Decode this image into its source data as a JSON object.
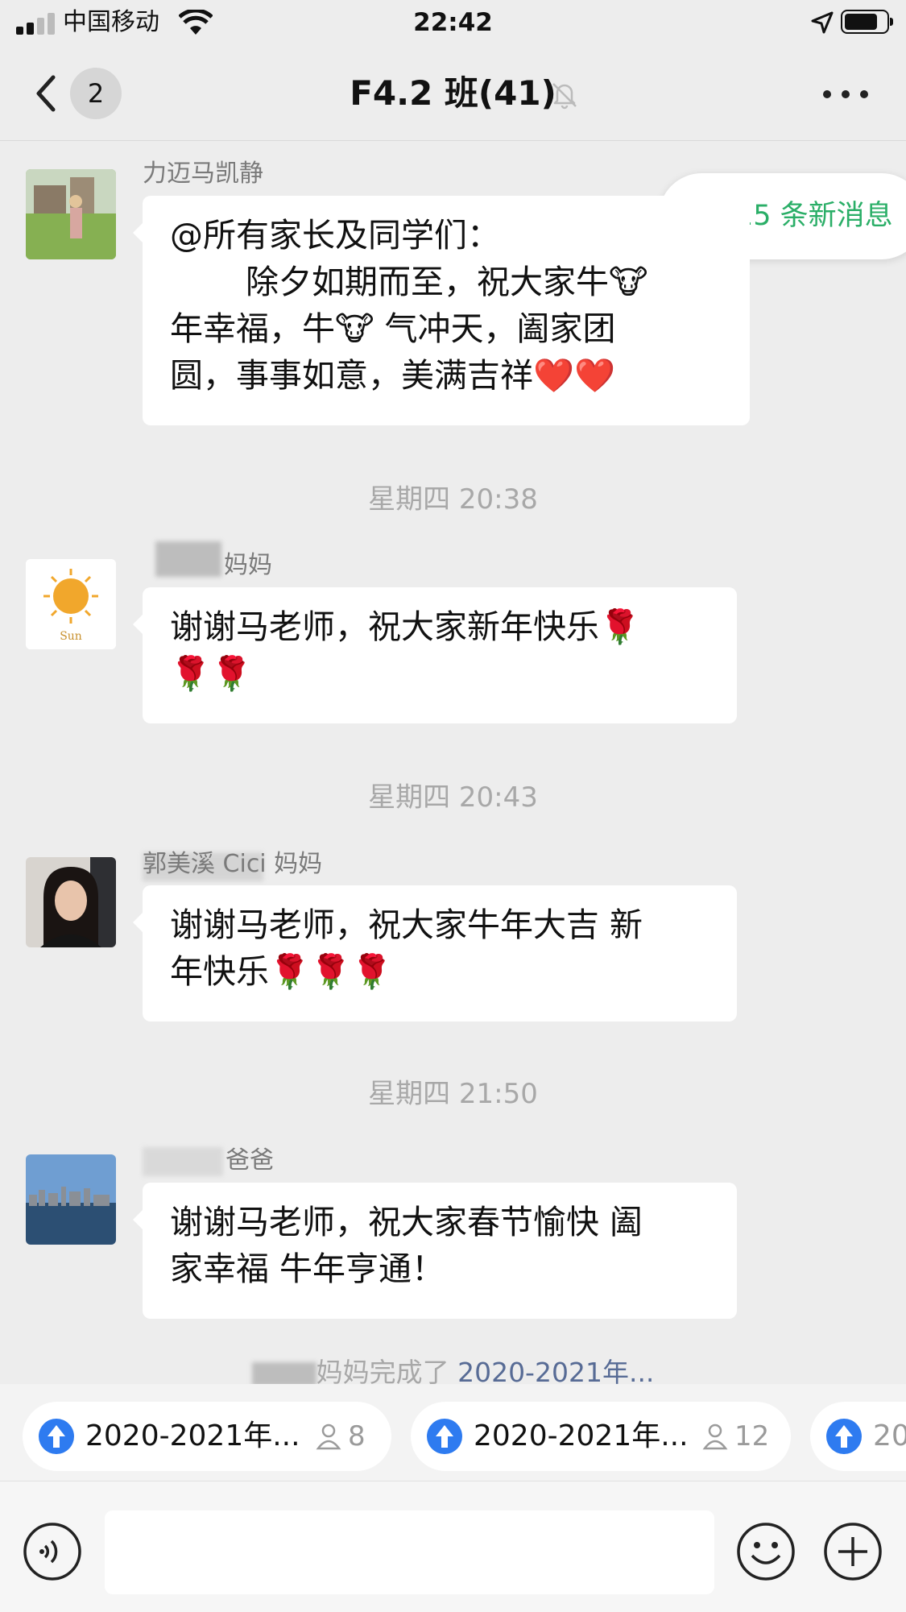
{
  "status_bar": {
    "carrier": "中国移动",
    "time": "22:42"
  },
  "nav": {
    "back_count": "2",
    "title": "F4.2 班(41)",
    "icons": [
      "chevron-left-icon",
      "bell-muted-icon",
      "more-dots-icon"
    ]
  },
  "new_messages": {
    "label": "15 条新消息",
    "color": "#2aae67"
  },
  "messages": [
    {
      "sender": "力迈马凯静",
      "text_lines": [
        "@所有家长及同学们：",
        "除夕如期而至，祝大家牛🐮",
        "年幸福，牛🐮 气冲天，阖家团",
        "圆，事事如意，美满吉祥❤️❤️"
      ]
    },
    {
      "time": "星期四 20:38",
      "sender": "妈妈",
      "text_lines": [
        "谢谢马老师，祝大家新年快乐🌹",
        "🌹🌹"
      ]
    },
    {
      "time": "星期四 20:43",
      "sender": "郭美溪 Cici 妈妈",
      "text_lines": [
        "谢谢马老师，祝大家牛年大吉 新",
        "年快乐🌹🌹🌹"
      ]
    },
    {
      "time": "星期四 21:50",
      "sender": "爸爸",
      "text_lines": [
        "谢谢马老师，祝大家春节愉快 阖",
        "家幸福 牛年亨通！"
      ]
    }
  ],
  "system_notice": {
    "prefix": "妈妈完成了",
    "link": "2020-2021年..."
  },
  "shortcuts": [
    {
      "label": "2020-2021年...",
      "count": "8"
    },
    {
      "label": "2020-2021年...",
      "count": "12"
    },
    {
      "label": "20"
    }
  ],
  "input_bar": {
    "icons": [
      "voice-icon",
      "emoji-icon",
      "plus-icon"
    ]
  }
}
